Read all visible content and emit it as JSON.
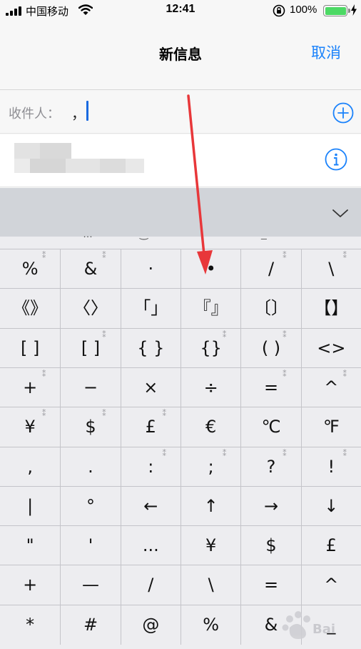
{
  "status_bar": {
    "carrier": "中国移动",
    "time": "12:41",
    "battery": "100%",
    "battery_level": 1.0,
    "icons": [
      "signal-icon",
      "wifi-icon",
      "orientation-lock-icon",
      "battery-icon",
      "charging-icon"
    ]
  },
  "nav": {
    "title": "新信息",
    "cancel": "取消"
  },
  "recipient": {
    "label": "收件人：",
    "value": "，"
  },
  "colors": {
    "accent": "#1a82fb",
    "battery": "#4cd964",
    "arrow": "#e8373a",
    "keyboard_bg": "#ededf0",
    "toolbar_bg": "#d1d4d9"
  },
  "keyboard": {
    "peek_row": [
      "…",
      "‿",
      "_"
    ],
    "rows": [
      [
        {
          "s": "%",
          "v": true
        },
        {
          "s": "&",
          "v": true
        },
        {
          "s": "·",
          "v": false
        },
        {
          "s": "•",
          "v": false
        },
        {
          "s": "/",
          "v": true
        },
        {
          "s": "\\",
          "v": true
        }
      ],
      [
        {
          "s": "《》",
          "v": false
        },
        {
          "s": "〈〉",
          "v": false
        },
        {
          "s": "「」",
          "v": false
        },
        {
          "s": "『』",
          "v": false
        },
        {
          "s": "〔〕",
          "v": false
        },
        {
          "s": "【】",
          "v": false
        }
      ],
      [
        {
          "s": "[ ]",
          "v": false
        },
        {
          "s": "[ ]",
          "v": true
        },
        {
          "s": "{ }",
          "v": false
        },
        {
          "s": "{}",
          "v": true
        },
        {
          "s": "( )",
          "v": true
        },
        {
          "s": "<>",
          "v": false
        }
      ],
      [
        {
          "s": "+",
          "v": true
        },
        {
          "s": "−",
          "v": false
        },
        {
          "s": "×",
          "v": false
        },
        {
          "s": "÷",
          "v": false
        },
        {
          "s": "=",
          "v": true
        },
        {
          "s": "^",
          "v": true
        }
      ],
      [
        {
          "s": "¥",
          "v": true
        },
        {
          "s": "$",
          "v": true
        },
        {
          "s": "£",
          "v": true
        },
        {
          "s": "€",
          "v": false
        },
        {
          "s": "℃",
          "v": false
        },
        {
          "s": "℉",
          "v": false
        }
      ],
      [
        {
          "s": ",",
          "v": false
        },
        {
          "s": ".",
          "v": false
        },
        {
          "s": ":",
          "v": true
        },
        {
          "s": ";",
          "v": true
        },
        {
          "s": "?",
          "v": true
        },
        {
          "s": "!",
          "v": true
        }
      ],
      [
        {
          "s": "|",
          "v": false
        },
        {
          "s": "°",
          "v": false
        },
        {
          "s": "←",
          "v": false
        },
        {
          "s": "↑",
          "v": false
        },
        {
          "s": "→",
          "v": false
        },
        {
          "s": "↓",
          "v": false
        }
      ],
      [
        {
          "s": "\"",
          "v": false
        },
        {
          "s": "'",
          "v": false
        },
        {
          "s": "...",
          "v": false
        },
        {
          "s": "¥",
          "v": false
        },
        {
          "s": "$",
          "v": false
        },
        {
          "s": "£",
          "v": false
        }
      ],
      [
        {
          "s": "+",
          "v": false
        },
        {
          "s": "—",
          "v": false
        },
        {
          "s": "/",
          "v": false
        },
        {
          "s": "\\",
          "v": false
        },
        {
          "s": "=",
          "v": false
        },
        {
          "s": "^",
          "v": false
        }
      ],
      [
        {
          "s": "*",
          "v": false
        },
        {
          "s": "#",
          "v": false
        },
        {
          "s": "@",
          "v": false
        },
        {
          "s": "%",
          "v": false
        },
        {
          "s": "&",
          "v": false
        },
        {
          "s": "_",
          "v": false
        }
      ]
    ],
    "variant_mark": "⁑"
  },
  "watermark": {
    "text": "Bai 经验"
  }
}
